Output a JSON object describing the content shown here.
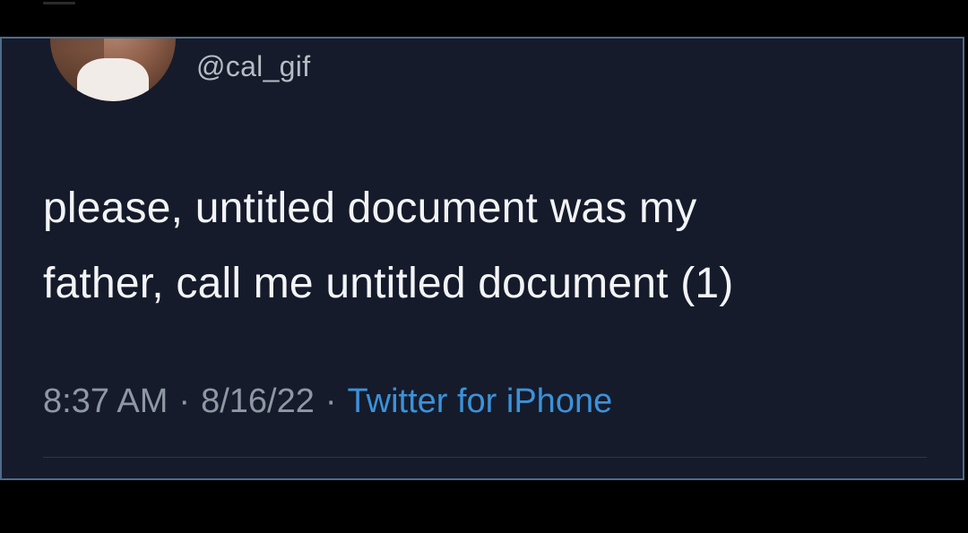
{
  "tweet": {
    "handle": "@cal_gif",
    "text_lines": [
      "please, untitled document was my",
      "father, call me untitled document (1)"
    ],
    "time": "8:37 AM",
    "date": "8/16/22",
    "separator": "·",
    "source": "Twitter for iPhone",
    "avatar_icon": "profile-photo"
  },
  "colors": {
    "background": "#000000",
    "card": "#151b2b",
    "border": "#4f6c8a",
    "text": "#f3f4f6",
    "meta": "#8e98a3",
    "link": "#3c92d9"
  }
}
